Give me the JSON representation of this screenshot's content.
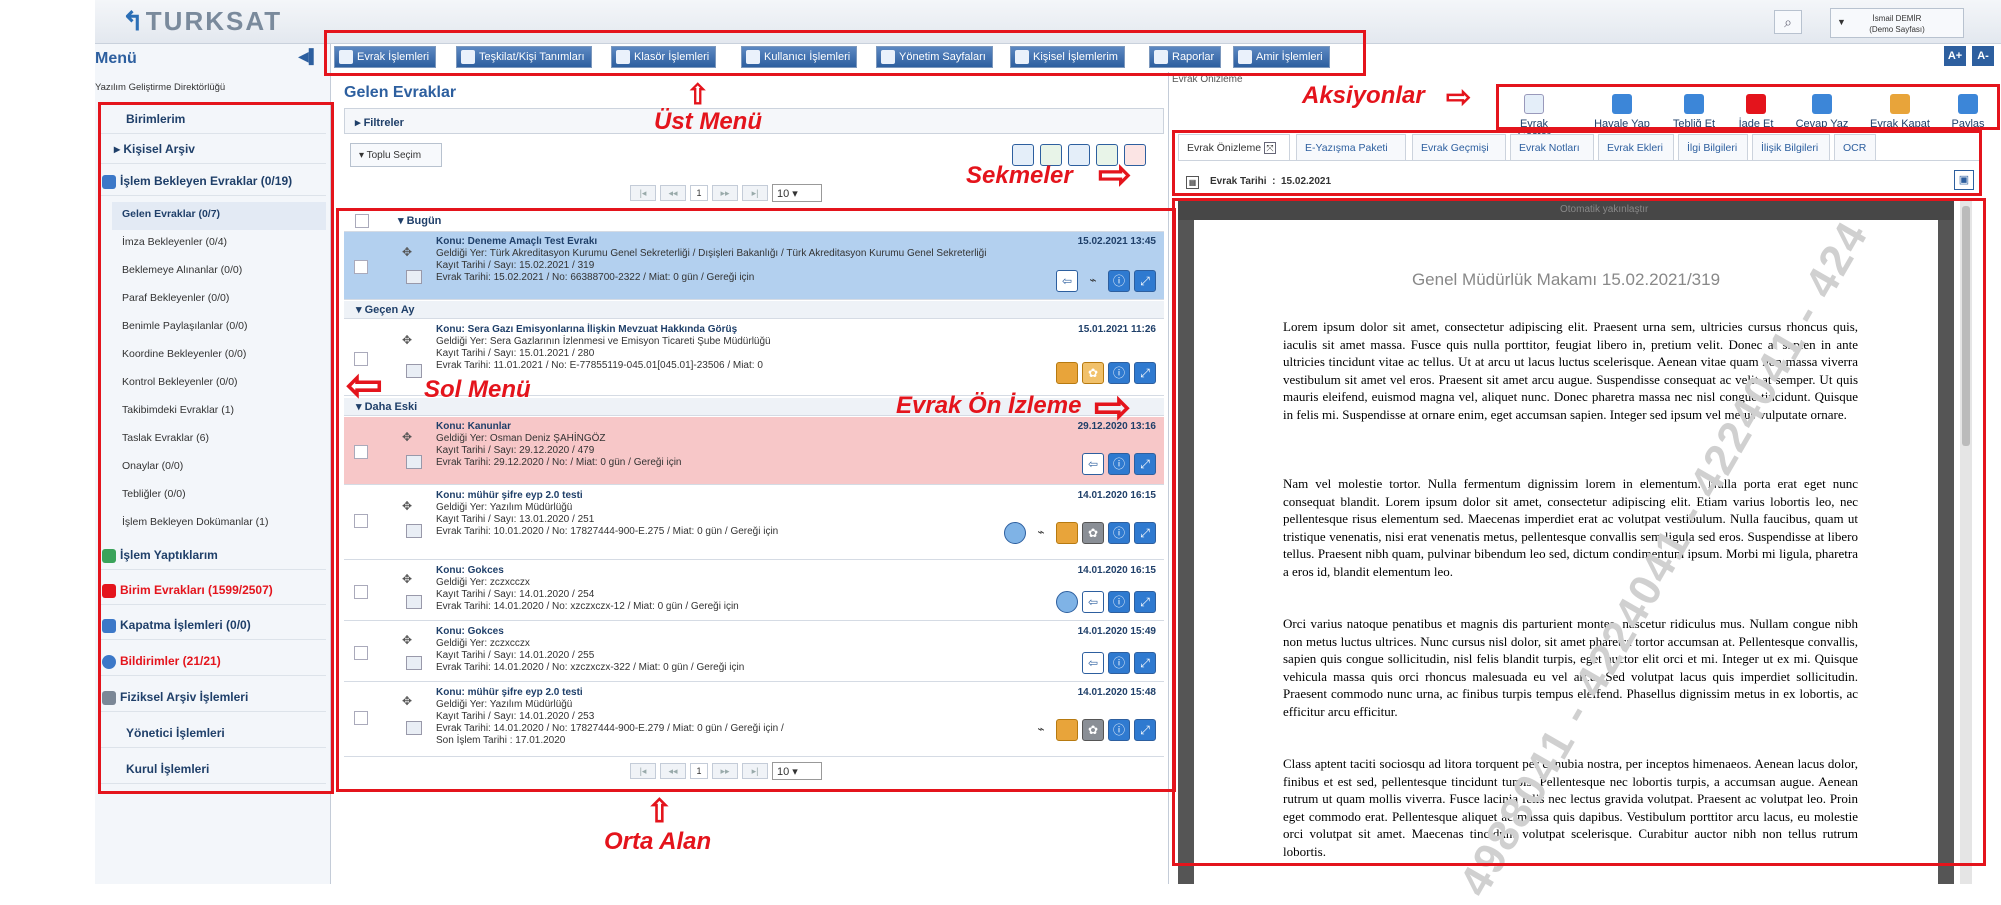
{
  "app": {
    "logo": "TURKSAT",
    "user_name": "İsmail DEMİR",
    "user_role": "(Demo Sayfası)"
  },
  "top_menu": [
    {
      "label": "Evrak İşlemleri"
    },
    {
      "label": "Teşkilat/Kişi Tanımları"
    },
    {
      "label": "Klasör İşlemleri"
    },
    {
      "label": "Kullanıcı İşlemleri"
    },
    {
      "label": "Yönetim Sayfaları"
    },
    {
      "label": "Kişisel İşlemlerim"
    },
    {
      "label": "Raporlar"
    },
    {
      "label": "Amir İşlemleri"
    }
  ],
  "font_buttons": [
    "A+",
    "A-"
  ],
  "left_menu": {
    "title": "Menü",
    "org": "Yazılım Geliştirme Direktörlüğü",
    "items": [
      {
        "label": "Birimlerim"
      },
      {
        "label": "Kişisel Arşiv"
      },
      {
        "label": "İşlem Bekleyen Evraklar (0/19)"
      },
      {
        "label": "Gelen Evraklar (0/7)"
      },
      {
        "label": "İmza Bekleyenler (0/4)"
      },
      {
        "label": "Beklemeye Alınanlar (0/0)"
      },
      {
        "label": "Paraf Bekleyenler (0/0)"
      },
      {
        "label": "Benimle Paylaşılanlar (0/0)"
      },
      {
        "label": "Koordine Bekleyenler (0/0)"
      },
      {
        "label": "Kontrol Bekleyenler (0/0)"
      },
      {
        "label": "Takibimdeki Evraklar (1)"
      },
      {
        "label": "Taslak Evraklar (6)"
      },
      {
        "label": "Onaylar (0/0)"
      },
      {
        "label": "Tebliğler (0/0)"
      },
      {
        "label": "İşlem Bekleyen Dokümanlar (1)"
      },
      {
        "label": "İşlem Yaptıklarım"
      },
      {
        "label": "Birim Evrakları (1599/2507)"
      },
      {
        "label": "Kapatma İşlemleri (0/0)"
      },
      {
        "label": "Bildirimler (21/21)"
      },
      {
        "label": "Fiziksel Arşiv İşlemleri"
      },
      {
        "label": "Yönetici İşlemleri"
      },
      {
        "label": "Kurul İşlemleri"
      }
    ]
  },
  "center": {
    "title": "Gelen Evraklar",
    "filters": "Filtreler",
    "bulk_select": "Toplu Seçim",
    "page": "1",
    "page_size": "10",
    "groups": {
      "today": "Bugün",
      "last_month": "Geçen Ay",
      "older": "Daha Eski"
    },
    "rows": [
      {
        "subject": "Konu: Deneme Amaçlı Test Evrakı",
        "from": "Geldiği Yer: Türk Akreditasyon Kurumu Genel Sekreterliği / Dışişleri Bakanlığı / Türk Akreditasyon Kurumu Genel Sekreterliği",
        "reg": "Kayıt Tarihi / Sayı: 15.02.2021 / 319",
        "doc": "Evrak Tarihi: 15.02.2021 / No: 66388700-2322 / Miat: 0 gün / Gereği için",
        "date": "15.02.2021 13:45"
      },
      {
        "subject": "Konu: Sera Gazı Emisyonlarına İlişkin Mevzuat Hakkında Görüş",
        "from": "Geldiği Yer: Sera Gazlarının İzlenmesi ve Emisyon Ticareti Şube Müdürlüğü",
        "reg": "Kayıt Tarihi / Sayı: 15.01.2021 / 280",
        "doc": "Evrak Tarihi: 11.01.2021 / No: E-77855119-045.01[045.01]-23506 / Miat: 0",
        "date": "15.01.2021 11:26"
      },
      {
        "subject": "Konu: Kanunlar",
        "from": "Geldiği Yer: Osman Deniz ŞAHİNGÖZ",
        "reg": "Kayıt Tarihi / Sayı: 29.12.2020 / 479",
        "doc": "Evrak Tarihi: 29.12.2020 / No: / Miat: 0 gün / Gereği için",
        "date": "29.12.2020 13:16"
      },
      {
        "subject": "Konu: mühür şifre eyp 2.0 testi",
        "from": "Geldiği Yer: Yazılım Müdürlüğü",
        "reg": "Kayıt Tarihi / Sayı: 13.01.2020 / 251",
        "doc": "Evrak Tarihi: 10.01.2020 / No: 17827444-900-E.275 / Miat: 0 gün / Gereği için",
        "date": "14.01.2020 16:15"
      },
      {
        "subject": "Konu: Gokces",
        "from": "Geldiği Yer: zczxcczx",
        "reg": "Kayıt Tarihi / Sayı: 14.01.2020 / 254",
        "doc": "Evrak Tarihi: 14.01.2020 / No: xzczxczx-12 / Miat: 0 gün / Gereği için",
        "date": "14.01.2020 16:15"
      },
      {
        "subject": "Konu: Gokces",
        "from": "Geldiği Yer: zczxcczx",
        "reg": "Kayıt Tarihi / Sayı: 14.01.2020 / 255",
        "doc": "Evrak Tarihi: 14.01.2020 / No: xzczxczx-322 / Miat: 0 gün / Gereği için",
        "date": "14.01.2020 15:49"
      },
      {
        "subject": "Konu: mühür şifre eyp 2.0 testi",
        "from": "Geldiği Yer: Yazılım Müdürlüğü",
        "reg": "Kayıt Tarihi / Sayı: 14.01.2020 / 253",
        "doc": "Evrak Tarihi: 14.01.2020 / No: 17827444-900-E.279 / Miat: 0 gün / Gereği için / Son İşlem Tarihi : 17.01.2020",
        "date": "14.01.2020 15:48"
      }
    ]
  },
  "right": {
    "preview_label": "Evrak Önizleme",
    "actions": [
      "Evrak Göster",
      "Havale Yap",
      "Tebliğ Et",
      "İade Et",
      "Cevap Yaz",
      "Evrak Kapat",
      "Paylaş"
    ],
    "tabs": [
      "Evrak Önizleme",
      "E-Yazışma Paketi",
      "Evrak Geçmişi",
      "Evrak Notları",
      "Evrak Ekleri",
      "İlgi Bilgileri",
      "İlişik Bilgileri",
      "OCR"
    ],
    "doc_date_label": "Evrak Tarihi",
    "doc_date_sep": ":",
    "doc_date": "15.02.2021",
    "pdf_zoom": "Otomatik yakınlaştır",
    "pdf_title": "Genel Müdürlük Makamı 15.02.2021/319",
    "paragraphs": [
      "Lorem ipsum dolor sit amet, consectetur adipiscing elit. Praesent urna sem, ultricies cursus rhoncus quis, iaculis sit amet massa. Fusce quis nulla porttitor, feugiat libero in, pretium velit. Donec at sapien in ante ultricies tincidunt vitae ac tellus. Ut at arcu ut lacus luctus scelerisque. Aenean vitae quam non massa viverra vestibulum sit amet vel eros. Praesent sit amet arcu augue. Suspendisse consequat ac velit at semper. Ut quis mauris eleifend, euismod magna vel, aliquet nunc. Donec pharetra massa nec nisl congue tincidunt. Quisque in felis mi. Suspendisse at ornare enim, eget accumsan sapien. Integer sed ipsum vel metus vulputate ornare.",
      "Nam vel molestie tortor. Nulla fermentum dignissim lorem in elementum. Nulla porta erat eget nunc consequat blandit. Lorem ipsum dolor sit amet, consectetur adipiscing elit. Etiam varius lobortis leo, nec pellentesque risus elementum sed. Maecenas imperdiet erat ac volutpat vestibulum. Nulla faucibus, quam ut tristique venenatis, nisi erat venenatis metus, pellentesque convallis sem ligula sed eros. Suspendisse at libero tellus. Praesent nibh quam, pulvinar bibendum leo sed, dictum condimentum ipsum. Morbi mi ligula, pharetra a eros id, blandit elementum leo.",
      "Orci varius natoque penatibus et magnis dis parturient montes, nascetur ridiculus mus. Nullam congue nibh non metus luctus ultrices. Nunc cursus nisl dolor, sit amet pharetra tortor accumsan at. Pellentesque convallis, sapien quis congue sollicitudin, nisl felis blandit turpis, eget auctor elit orci et mi. Integer ut ex mi. Quisque vehicula massa quis orci rhoncus malesuada eu vel arcu. Sed volutpat lacus quis imperdiet sollicitudin. Praesent commodo nunc urna, ac finibus turpis tempus eleifend. Phasellus dignissim metus in ex lobortis, ac efficitur arcu efficitur.",
      "Class aptent taciti sociosqu ad litora torquent per conubia nostra, per inceptos himenaeos. Aenean lacus dolor, finibus et est sed, pellentesque tincidunt turpis. Pellentesque nec lobortis turpis, a accumsan augue. Aenean rutrum ut quam mollis viverra. Fusce lacinia felis nec lectus gravida volutpat. Praesent ac volutpat leo. Proin eget commodo erat. Pellentesque aliquet ac massa quis dapibus. Vestibulum porttitor arcu lacus, eu molestie orci volutpat sit amet. Maecenas tincidunt volutpat scelerisque. Curabitur auctor nibh non tellus rutrum lobortis."
    ],
    "watermark": "4988041 - 4224041 - 4224041 - 424"
  },
  "annotations": {
    "ust_menu": "Üst Menü",
    "aksiyonlar": "Aksiyonlar",
    "sekmeler": "Sekmeler",
    "sol_menu": "Sol Menü",
    "evrak_on_izleme": "Evrak Ön İzleme",
    "orta_alan": "Orta Alan",
    "color": "#e4141c"
  }
}
